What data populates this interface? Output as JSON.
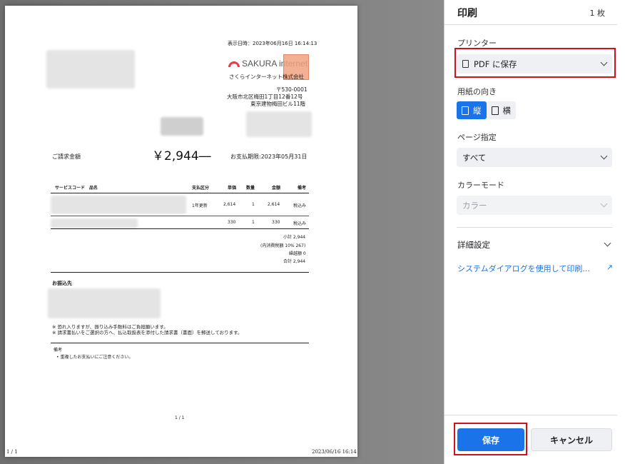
{
  "panel": {
    "title": "印刷",
    "sheet_count": "1 枚",
    "printer_label": "プリンター",
    "printer_value": "PDF に保存",
    "orientation_label": "用紙の向き",
    "orientation_portrait": "縦",
    "orientation_landscape": "横",
    "pages_label": "ページ指定",
    "pages_value": "すべて",
    "color_label": "カラーモード",
    "color_value": "カラー",
    "more_settings": "詳細設定",
    "system_dialog": "システムダイアログを使用して印刷...",
    "save_button": "保存",
    "cancel_button": "キャンセル",
    "highlight_color": "#d0101e",
    "accent_color": "#1a73e8"
  },
  "invoice": {
    "display_datetime": "表示日時：2023年06月16日 16:14:13",
    "company_logo_text": "SAKURA internet",
    "company_name": "さくらインターネット株式会社",
    "postal": "〒530-0001",
    "address1": "大阪市北区梅田1丁目12番12号",
    "address2": "東京建物梅田ビル11階",
    "billing_label": "ご請求金額",
    "billing_amount": "￥2,944―",
    "due_label": "お支払期限:2023年05月31日",
    "table_headers": [
      "サービスコード　品名",
      "支払区分",
      "単価",
      "数量",
      "金額",
      "備考"
    ],
    "rows": [
      {
        "category": "1年更新",
        "unit": "2,614",
        "qty": "1",
        "amount": "2,614",
        "note": "税込み"
      },
      {
        "category": "",
        "unit": "330",
        "qty": "1",
        "amount": "330",
        "note": "税込み"
      }
    ],
    "subtotal": "小計 2,944",
    "tax": "(内消費税額 10% 267)",
    "carryover": "繰越額 0",
    "total": "合計 2,944",
    "bank_heading": "お振込先",
    "note1": "※ 恐れ入りますが、振り込み手数料はご負担願います。",
    "note2": "※ 請求書払いをご選択の方へ、払込取扱表を添付した請求書（書面）を郵送しております。",
    "remarks_heading": "備考",
    "remarks_item": "• 重複したお支払いにご注意ください。",
    "page_number": "1 / 1",
    "footer_left": "1 / 1",
    "footer_right": "2023/06/16 16:14"
  }
}
